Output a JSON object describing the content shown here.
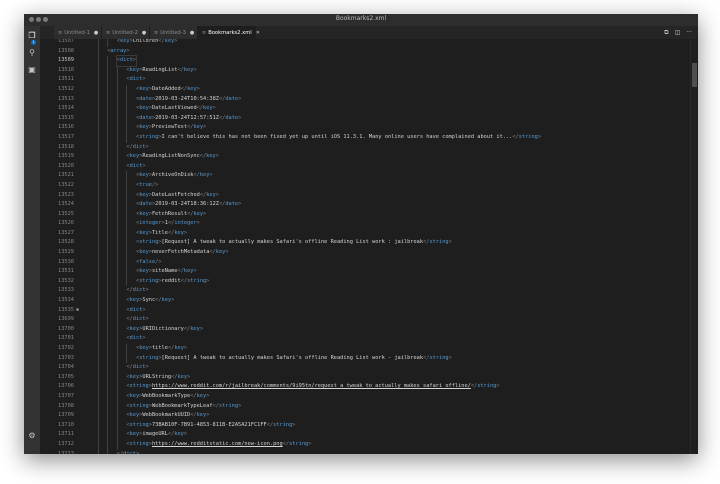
{
  "window": {
    "title": "Bookmarks2.xml"
  },
  "tabs": [
    {
      "label": "Untitled-1",
      "active": false
    },
    {
      "label": "Untitled-2",
      "active": false
    },
    {
      "label": "Untitled-3",
      "active": false
    },
    {
      "label": "Bookmarks2.xml",
      "active": true
    }
  ],
  "tab_actions": [
    {
      "name": "open-changes-icon",
      "glyph": "⧉"
    },
    {
      "name": "split-editor-icon",
      "glyph": "◫"
    },
    {
      "name": "more-actions-icon",
      "glyph": "···"
    }
  ],
  "activity_bar": [
    {
      "name": "explorer-icon",
      "glyph": "❐"
    },
    {
      "name": "search-icon",
      "glyph": "⚲"
    },
    {
      "name": "extensions-icon",
      "glyph": "▣"
    },
    {
      "name": "settings-gear-icon",
      "glyph": "⚙"
    }
  ],
  "explorer_badge": "1",
  "colors": {
    "tag": "#569cd6",
    "bracket": "#808080",
    "text": "#d4d4d4",
    "background": "#1e1e1e"
  },
  "editor_lines": [
    {
      "num": "13507",
      "indent": 3,
      "tag": "key",
      "text": "Children"
    },
    {
      "num": "13508",
      "indent": 2,
      "open": "array"
    },
    {
      "num": "13509",
      "indent": 3,
      "open": "dict",
      "current": true
    },
    {
      "num": "13510",
      "indent": 4,
      "tag": "key",
      "text": "ReadingList"
    },
    {
      "num": "13511",
      "indent": 4,
      "open": "dict"
    },
    {
      "num": "13512",
      "indent": 5,
      "tag": "key",
      "text": "DateAdded"
    },
    {
      "num": "13513",
      "indent": 5,
      "tag": "date",
      "text": "2019-03-24T10:54:38Z"
    },
    {
      "num": "13514",
      "indent": 5,
      "tag": "key",
      "text": "DateLastViewed"
    },
    {
      "num": "13515",
      "indent": 5,
      "tag": "date",
      "text": "2019-03-24T12:57:51Z"
    },
    {
      "num": "13516",
      "indent": 5,
      "tag": "key",
      "text": "PreviewText"
    },
    {
      "num": "13517",
      "indent": 5,
      "tag": "string",
      "text": "I can't believe this has not been fixed yet up until iOS 11.3.1. Many online users have complained about it..."
    },
    {
      "num": "13518",
      "indent": 4,
      "close": "dict"
    },
    {
      "num": "13519",
      "indent": 4,
      "tag": "key",
      "text": "ReadingListNonSync"
    },
    {
      "num": "13520",
      "indent": 4,
      "open": "dict"
    },
    {
      "num": "13521",
      "indent": 5,
      "tag": "key",
      "text": "ArchiveOnDisk"
    },
    {
      "num": "13522",
      "indent": 5,
      "selfclose": "true"
    },
    {
      "num": "13523",
      "indent": 5,
      "tag": "key",
      "text": "DateLastFetched"
    },
    {
      "num": "13524",
      "indent": 5,
      "tag": "date",
      "text": "2019-03-24T18:36:12Z"
    },
    {
      "num": "13525",
      "indent": 5,
      "tag": "key",
      "text": "FetchResult"
    },
    {
      "num": "13526",
      "indent": 5,
      "tag": "integer",
      "text": "1"
    },
    {
      "num": "13527",
      "indent": 5,
      "tag": "key",
      "text": "Title"
    },
    {
      "num": "13528",
      "indent": 5,
      "tag": "string",
      "text": "[Request] A tweak to actually makes Safari's offline Reading List work : jailbreak"
    },
    {
      "num": "13529",
      "indent": 5,
      "tag": "key",
      "text": "neverFetchMetadata"
    },
    {
      "num": "13530",
      "indent": 5,
      "selfclose": "false"
    },
    {
      "num": "13531",
      "indent": 5,
      "tag": "key",
      "text": "siteName"
    },
    {
      "num": "13532",
      "indent": 5,
      "tag": "string",
      "text": "reddit"
    },
    {
      "num": "13533",
      "indent": 4,
      "close": "dict"
    },
    {
      "num": "13534",
      "indent": 4,
      "tag": "key",
      "text": "Sync"
    },
    {
      "num": "13535",
      "indent": 4,
      "open": "dict",
      "folded": true
    },
    {
      "num": "13699",
      "indent": 4,
      "close": "dict"
    },
    {
      "num": "13700",
      "indent": 4,
      "tag": "key",
      "text": "URIDictionary"
    },
    {
      "num": "13701",
      "indent": 4,
      "open": "dict"
    },
    {
      "num": "13702",
      "indent": 5,
      "tag": "key",
      "text": "title"
    },
    {
      "num": "13703",
      "indent": 5,
      "tag": "string",
      "text": "[Request] A tweak to actually makes Safari's offline Reading List work - jailbreak"
    },
    {
      "num": "13704",
      "indent": 4,
      "close": "dict"
    },
    {
      "num": "13705",
      "indent": 4,
      "tag": "key",
      "text": "URLString"
    },
    {
      "num": "13706",
      "indent": 4,
      "tag": "string",
      "text": "https://www.reddit.com/r/jailbreak/comments/9i95tn/request_a_tweak_to_actually_makes_safari_offline/",
      "link": true
    },
    {
      "num": "13707",
      "indent": 4,
      "tag": "key",
      "text": "WebBookmarkType"
    },
    {
      "num": "13708",
      "indent": 4,
      "tag": "string",
      "text": "WebBookmarkTypeLeaf"
    },
    {
      "num": "13709",
      "indent": 4,
      "tag": "key",
      "text": "WebBookmarkUUID"
    },
    {
      "num": "13710",
      "indent": 4,
      "tag": "string",
      "text": "73BAB10F-7B91-4853-811B-E2A5A21FC1FF"
    },
    {
      "num": "13711",
      "indent": 4,
      "tag": "key",
      "text": "imageURL"
    },
    {
      "num": "13712",
      "indent": 4,
      "tag": "string",
      "text": "https://www.redditstatic.com/new-icon.png",
      "link": true
    },
    {
      "num": "13713",
      "indent": 3,
      "close": "dict"
    }
  ]
}
